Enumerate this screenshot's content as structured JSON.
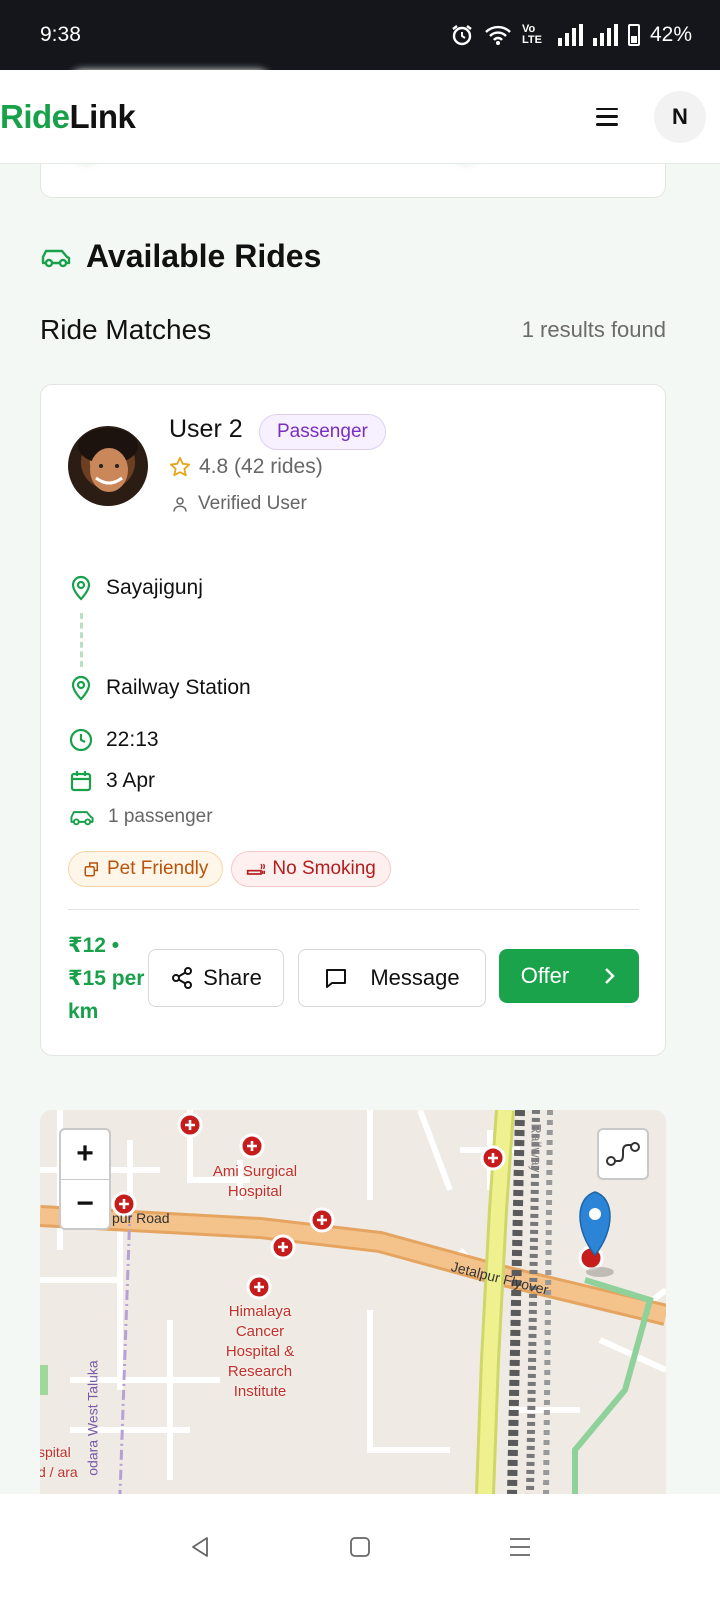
{
  "status_bar": {
    "time": "9:38",
    "network": "Vo LTE",
    "battery": "42%",
    "icons": [
      "alarm-icon",
      "wifi-icon",
      "signal-icon",
      "signal-icon",
      "battery-icon"
    ]
  },
  "header": {
    "logo_part1": "Ride",
    "logo_part2": "Link",
    "menu_icon": "hamburger-icon",
    "avatar_initial": "N"
  },
  "section": {
    "title": "Available Rides",
    "icon": "car-icon"
  },
  "matches": {
    "title": "Ride Matches",
    "results": "1 results found"
  },
  "ride": {
    "user_name": "User 2",
    "role": "Passenger",
    "rating": "4.8 (42 rides)",
    "verified": "Verified User",
    "from": "Sayajigunj",
    "to": "Railway Station",
    "time": "22:13",
    "date": "3 Apr",
    "passengers": "1 passenger",
    "tags": [
      "Pet Friendly",
      "No Smoking"
    ],
    "price": "₹12 • ₹15 per km",
    "share_label": "Share",
    "message_label": "Message",
    "offer_label": "Offer"
  },
  "map": {
    "zoom_in": "+",
    "zoom_out": "−",
    "labels": {
      "hospital1": "Ami Surgical Hospital",
      "hospital2": "Himalaya Cancer Hospital & Research Institute",
      "road1": "pur Road",
      "road2": "Jetalpur Flyover",
      "railway": "Railway",
      "taluka": "odara West Taluka",
      "edge": "spital d / ara"
    }
  },
  "colors": {
    "brand_green": "#18a14a",
    "passenger_purple": "#7a2fc1",
    "pet_orange": "#b8530c",
    "smoke_red": "#b31d1d"
  }
}
